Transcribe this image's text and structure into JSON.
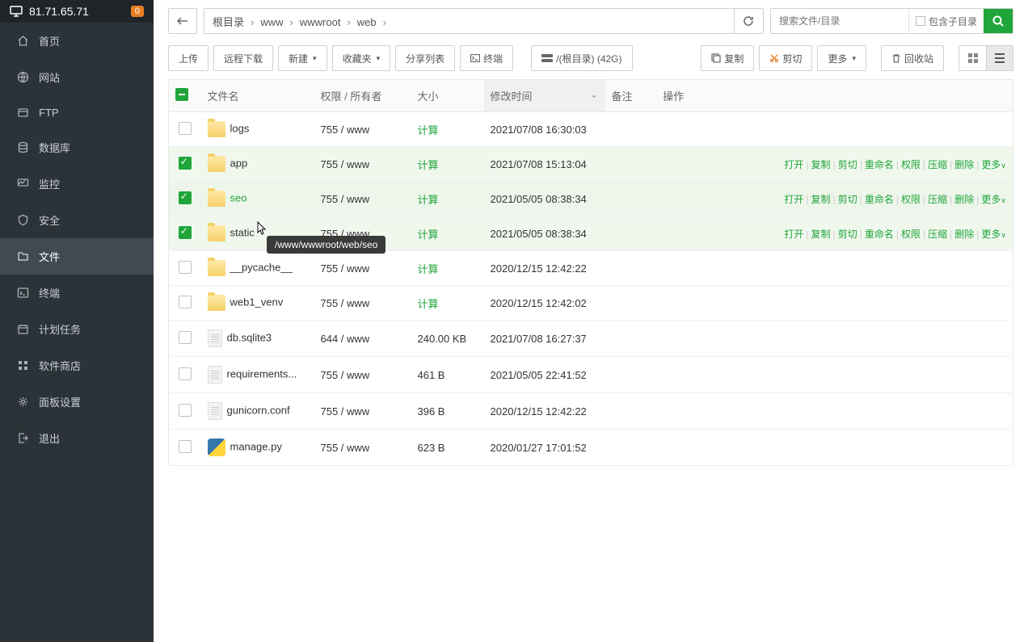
{
  "header": {
    "ip": "81.71.65.71",
    "badge": "0"
  },
  "sidebar": {
    "items": [
      {
        "label": "首页",
        "icon": "home"
      },
      {
        "label": "网站",
        "icon": "globe"
      },
      {
        "label": "FTP",
        "icon": "ftp"
      },
      {
        "label": "数据库",
        "icon": "database"
      },
      {
        "label": "监控",
        "icon": "monitor"
      },
      {
        "label": "安全",
        "icon": "shield"
      },
      {
        "label": "文件",
        "icon": "folder",
        "active": true
      },
      {
        "label": "终端",
        "icon": "terminal"
      },
      {
        "label": "计划任务",
        "icon": "calendar"
      },
      {
        "label": "软件商店",
        "icon": "apps"
      },
      {
        "label": "面板设置",
        "icon": "gear"
      },
      {
        "label": "退出",
        "icon": "logout"
      }
    ]
  },
  "breadcrumb": {
    "items": [
      "根目录",
      "www",
      "wwwroot",
      "web"
    ]
  },
  "search": {
    "placeholder": "搜索文件/目录",
    "subdir_label": "包含子目录"
  },
  "toolbar": {
    "upload": "上传",
    "remote_download": "远程下载",
    "new": "新建",
    "favorites": "收藏夹",
    "share_list": "分享列表",
    "terminal": "终端",
    "disk": "/(根目录) (42G)",
    "copy": "复制",
    "cut": "剪切",
    "more": "更多",
    "recycle": "回收站"
  },
  "columns": {
    "name": "文件名",
    "perm": "权限 / 所有者",
    "size": "大小",
    "mtime": "修改时间",
    "note": "备注",
    "actions": "操作"
  },
  "calc_label": "计算",
  "row_actions": [
    "打开",
    "复制",
    "剪切",
    "重命名",
    "权限",
    "压缩",
    "删除",
    "更多"
  ],
  "tooltip_text": "/www/wwwroot/web/seo",
  "files": [
    {
      "name": "logs",
      "type": "folder",
      "perm": "755 / www",
      "size": "calc",
      "mtime": "2021/07/08 16:30:03",
      "selected": false
    },
    {
      "name": "app",
      "type": "folder",
      "perm": "755 / www",
      "size": "calc",
      "mtime": "2021/07/08 15:13:04",
      "selected": true,
      "show_actions": true
    },
    {
      "name": "seo",
      "type": "folder",
      "perm": "755 / www",
      "size": "calc",
      "mtime": "2021/05/05 08:38:34",
      "selected": true,
      "show_actions": true,
      "hovered": true
    },
    {
      "name": "static",
      "type": "folder",
      "perm": "755 / www",
      "size": "calc",
      "mtime": "2021/05/05 08:38:34",
      "selected": true,
      "show_actions": true
    },
    {
      "name": "__pycache__",
      "type": "folder",
      "perm": "755 / www",
      "size": "calc",
      "mtime": "2020/12/15 12:42:22",
      "selected": false
    },
    {
      "name": "web1_venv",
      "type": "folder",
      "perm": "755 / www",
      "size": "calc",
      "mtime": "2020/12/15 12:42:02",
      "selected": false
    },
    {
      "name": "db.sqlite3",
      "type": "file",
      "perm": "644 / www",
      "size": "240.00 KB",
      "mtime": "2021/07/08 16:27:37",
      "selected": false
    },
    {
      "name": "requirements...",
      "type": "file",
      "perm": "755 / www",
      "size": "461 B",
      "mtime": "2021/05/05 22:41:52",
      "selected": false
    },
    {
      "name": "gunicorn.conf",
      "type": "file",
      "perm": "755 / www",
      "size": "396 B",
      "mtime": "2020/12/15 12:42:22",
      "selected": false
    },
    {
      "name": "manage.py",
      "type": "python",
      "perm": "755 / www",
      "size": "623 B",
      "mtime": "2020/01/27 17:01:52",
      "selected": false
    }
  ]
}
